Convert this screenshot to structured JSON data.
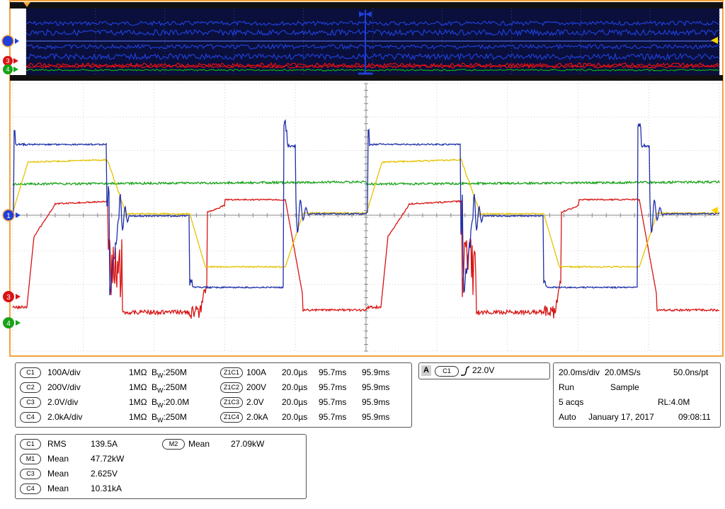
{
  "display": {
    "overview_colors": {
      "bg": "#0a0f3c",
      "blue": "#1f3fd8",
      "red": "#e01010",
      "green": "#10b010"
    },
    "colors": {
      "frame": "#f3a23c",
      "c1": "#1f2fa8",
      "c2": "#ffd400",
      "c3": "#17a317",
      "c4": "#d81414",
      "grid": "#9a9a9a"
    },
    "markers": {
      "main_ch1": "1",
      "main_ch3": "3",
      "main_ch4": "4",
      "ov_ch3": "3",
      "ov_ch4": "4"
    }
  },
  "channels": [
    {
      "id": "C1",
      "scale": "100A/div",
      "imp": "1MΩ",
      "bw": "250M",
      "zid": "Z1C1",
      "zscale": "100A",
      "zt": "20.0µs",
      "zpos": "95.7ms",
      "zend": "95.9ms"
    },
    {
      "id": "C2",
      "scale": "200V/div",
      "imp": "1MΩ",
      "bw": "250M",
      "zid": "Z1C2",
      "zscale": "200V",
      "zt": "20.0µs",
      "zpos": "95.7ms",
      "zend": "95.9ms"
    },
    {
      "id": "C3",
      "scale": "2.0V/div",
      "imp": "1MΩ",
      "bw": "20.0M",
      "zid": "Z1C3",
      "zscale": "2.0V",
      "zt": "20.0µs",
      "zpos": "95.7ms",
      "zend": "95.9ms"
    },
    {
      "id": "C4",
      "scale": "2.0kA/div",
      "imp": "1MΩ",
      "bw": "250M",
      "zid": "Z1C4",
      "zscale": "2.0kA",
      "zt": "20.0µs",
      "zpos": "95.7ms",
      "zend": "95.9ms"
    }
  ],
  "trigger": {
    "mode": "A",
    "source": "C1",
    "level": "22.0V"
  },
  "timebase": {
    "time_div": "20.0ms/div",
    "sample_rate": "20.0MS/s",
    "pt": "50.0ns/pt",
    "state": "Run",
    "acq_mode": "Sample",
    "acqs": "5 acqs",
    "rl": "RL:4.0M",
    "trig_mode": "Auto",
    "date": "January 17, 2017",
    "time": "09:08:11"
  },
  "measurements": {
    "left": [
      {
        "src": "C1",
        "type": "RMS",
        "value": "139.5A"
      },
      {
        "src": "M1",
        "type": "Mean",
        "value": "47.72kW"
      },
      {
        "src": "C3",
        "type": "Mean",
        "value": "2.625V"
      },
      {
        "src": "C4",
        "type": "Mean",
        "value": "10.31kA"
      }
    ],
    "right": {
      "src": "M2",
      "type": "Mean",
      "value": "27.09kW"
    }
  }
}
